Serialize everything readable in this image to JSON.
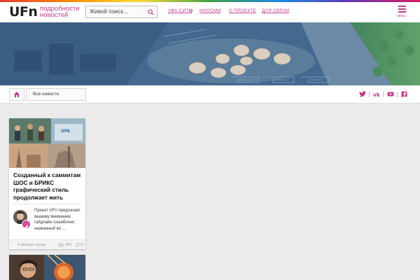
{
  "header": {
    "logo": "UFn",
    "tagline_line1": "подробности",
    "tagline_line2": "новостей",
    "search_placeholder": "Живой поиск...",
    "nav": [
      {
        "label": "Уфа Сити"
      },
      {
        "label": "Иносми"
      },
      {
        "label": "О проекте"
      },
      {
        "label": "Для связи"
      }
    ],
    "menu_label": "MENU",
    "accent_color": "#c03d8a"
  },
  "toolbar": {
    "home_icon": "home-icon",
    "all_news_label": "Все новости",
    "social_icons": [
      "twitter-icon",
      "vk-icon",
      "youtube-icon",
      "facebook-icon"
    ]
  },
  "article": {
    "title": "Созданный к саммитам ШОС и БРИКС графический стиль продолжает жить",
    "excerpt": "Проект UFn предлагает вашему вниманию гайдлайн (ошибочно названный во ...",
    "time_ago": "4 месяца назад",
    "views": "393",
    "comments": "0"
  }
}
